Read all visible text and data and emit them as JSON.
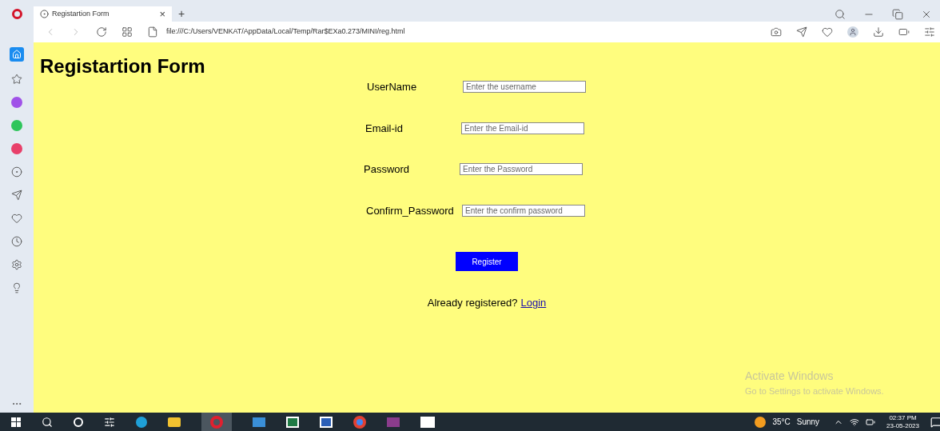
{
  "browser": {
    "tab": {
      "title": "Registartion Form",
      "close": "×",
      "new_tab": "+"
    },
    "url": "file:///C:/Users/VENKAT/AppData/Local/Temp/Rar$EXa0.273/MINI/reg.html"
  },
  "page": {
    "title": "Registartion Form",
    "fields": [
      {
        "label": "UserName",
        "placeholder": "Enter the username"
      },
      {
        "label": "Email-id",
        "placeholder": "Enter the Email-id"
      },
      {
        "label": "Password",
        "placeholder": "Enter the Password"
      },
      {
        "label": "Confirm_Password",
        "placeholder": "Enter the confirm password"
      }
    ],
    "button": "Register",
    "login_prompt": "Already registered?",
    "login_link": "Login"
  },
  "activation_notice": {
    "title": "Activate Windows",
    "subtitle": "Go to Settings to activate Windows."
  },
  "taskbar": {
    "temperature": "35°C",
    "weather": "Sunny",
    "time": "02:37 PM",
    "date": "23-05-2023"
  }
}
